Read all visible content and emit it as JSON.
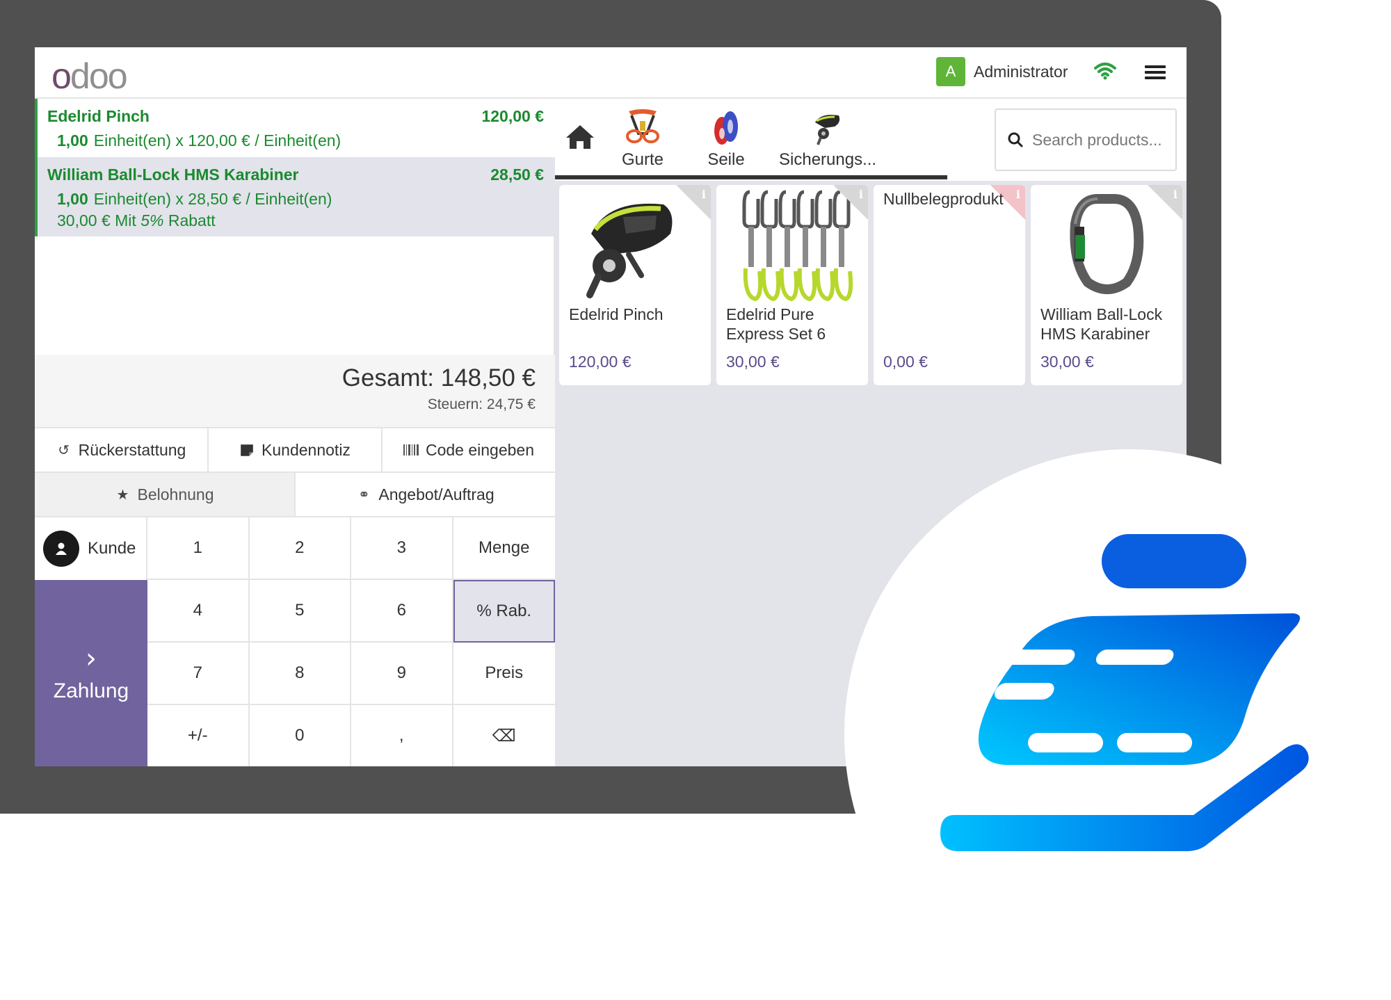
{
  "topbar": {
    "logo": "odoo",
    "user_initial": "A",
    "user_name": "Administrator"
  },
  "order": {
    "lines": [
      {
        "name": "Edelrid Pinch",
        "price": "120,00 €",
        "qty": "1,00",
        "detail": "Einheit(en) x 120,00 € / Einheit(en)"
      },
      {
        "name": "William Ball-Lock HMS Karabiner",
        "price": "28,50 €",
        "qty": "1,00",
        "detail": "Einheit(en) x 28,50 € / Einheit(en)",
        "discount_prefix": "30,00 € Mit",
        "discount_pct": "5%",
        "discount_suffix": "Rabatt"
      }
    ],
    "total": "Gesamt: 148,50 €",
    "tax": "Steuern: 24,75 €"
  },
  "controls": {
    "refund": "Rückerstattung",
    "note": "Kundennotiz",
    "code": "Code eingeben",
    "reward": "Belohnung",
    "quote": "Angebot/Auftrag"
  },
  "numpad": {
    "customer": "Kunde",
    "payment": "Zahlung",
    "keys": [
      "1",
      "2",
      "3",
      "Menge",
      "4",
      "5",
      "6",
      "% Rab.",
      "7",
      "8",
      "9",
      "Preis",
      "+/-",
      "0",
      ",",
      "⌫"
    ]
  },
  "categories": [
    {
      "label": "Gurte",
      "icon": "harness-icon"
    },
    {
      "label": "Seile",
      "icon": "rope-icon"
    },
    {
      "label": "Sicherungs...",
      "icon": "belay-device-icon"
    }
  ],
  "search": {
    "placeholder": "Search products..."
  },
  "products": [
    {
      "name": "Edelrid Pinch",
      "price": "120,00 €",
      "icon": "belay-device-image"
    },
    {
      "name": "Edelrid Pure Express Set 6",
      "price": "30,00 €",
      "icon": "quickdraw-set-image"
    },
    {
      "name": "Nullbelegprodukt",
      "price": "0,00 €",
      "icon": "none"
    },
    {
      "name": "William Ball-Lock HMS Karabiner",
      "price": "30,00 €",
      "icon": "carabiner-image"
    }
  ],
  "colors": {
    "accent": "#71639e",
    "order_green": "#1b8a2f",
    "price_purple": "#5b4b8a",
    "brand_blue": "#0066e6",
    "brand_cyan": "#00c8ff"
  }
}
